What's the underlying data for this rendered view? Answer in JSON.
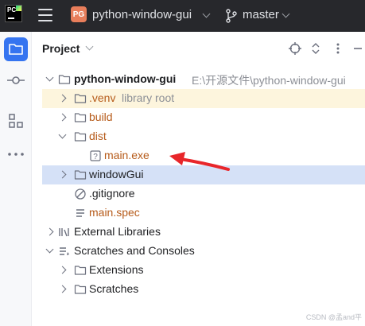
{
  "titlebar": {
    "project_badge": "PG",
    "project_name": "python-window-gui",
    "branch": "master"
  },
  "header": {
    "title": "Project"
  },
  "tree": {
    "root": {
      "name": "python-window-gui",
      "path": "E:\\开源文件\\python-window-gui"
    },
    "venv": {
      "name": ".venv",
      "hint": "library root"
    },
    "build": "build",
    "dist": "dist",
    "main_exe": "main.exe",
    "window_gui": "windowGui",
    "gitignore": ".gitignore",
    "main_spec": "main.spec",
    "external_libraries": "External Libraries",
    "scratches_consoles": "Scratches and Consoles",
    "extensions": "Extensions",
    "scratches": "Scratches"
  },
  "colors": {
    "accent": "#3574f0",
    "excluded_folder_text": "#b65b1a",
    "selection_blue": "#d5e1f7",
    "arrow_annotation": "#e8262a"
  },
  "watermark": "CSDN @孟and平"
}
